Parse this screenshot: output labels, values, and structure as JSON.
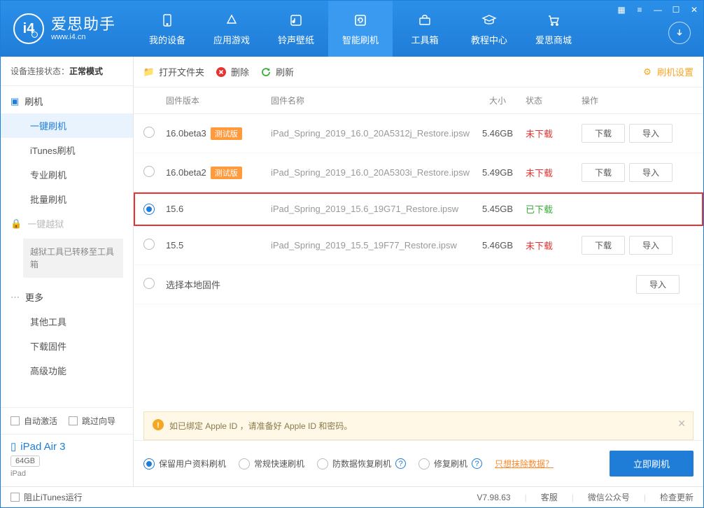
{
  "app": {
    "name": "爱思助手",
    "url": "www.i4.cn",
    "version": "V7.98.63"
  },
  "nav": [
    {
      "label": "我的设备"
    },
    {
      "label": "应用游戏"
    },
    {
      "label": "铃声壁纸"
    },
    {
      "label": "智能刷机"
    },
    {
      "label": "工具箱"
    },
    {
      "label": "教程中心"
    },
    {
      "label": "爱思商城"
    }
  ],
  "sidebar": {
    "status_prefix": "设备连接状态：",
    "status_value": "正常模式",
    "groups": {
      "flash": "刷机",
      "jailbreak": "一键越狱",
      "more": "更多"
    },
    "flash_items": [
      "一键刷机",
      "iTunes刷机",
      "专业刷机",
      "批量刷机"
    ],
    "jailbreak_note": "越狱工具已转移至工具箱",
    "more_items": [
      "其他工具",
      "下载固件",
      "高级功能"
    ],
    "auto_activate": "自动激活",
    "skip_guide": "跳过向导",
    "device": {
      "name": "iPad Air 3",
      "capacity": "64GB",
      "type": "iPad"
    }
  },
  "toolbar": {
    "open": "打开文件夹",
    "delete": "删除",
    "refresh": "刷新",
    "settings": "刷机设置"
  },
  "table": {
    "headers": {
      "version": "固件版本",
      "name": "固件名称",
      "size": "大小",
      "status": "状态",
      "ops": "操作"
    },
    "rows": [
      {
        "version": "16.0beta3",
        "beta": "测试版",
        "name": "iPad_Spring_2019_16.0_20A5312j_Restore.ipsw",
        "size": "5.46GB",
        "status": "未下载",
        "status_class": "red",
        "selected": false,
        "show_ops": true
      },
      {
        "version": "16.0beta2",
        "beta": "测试版",
        "name": "iPad_Spring_2019_16.0_20A5303i_Restore.ipsw",
        "size": "5.49GB",
        "status": "未下载",
        "status_class": "red",
        "selected": false,
        "show_ops": true
      },
      {
        "version": "15.6",
        "beta": "",
        "name": "iPad_Spring_2019_15.6_19G71_Restore.ipsw",
        "size": "5.45GB",
        "status": "已下载",
        "status_class": "green",
        "selected": true,
        "highlighted": true,
        "show_ops": false
      },
      {
        "version": "15.5",
        "beta": "",
        "name": "iPad_Spring_2019_15.5_19F77_Restore.ipsw",
        "size": "5.46GB",
        "status": "未下载",
        "status_class": "red",
        "selected": false,
        "show_ops": true
      },
      {
        "version": "",
        "beta": "",
        "name_main": "选择本地固件",
        "size": "",
        "status": "",
        "selected": false,
        "import_only": true
      }
    ],
    "download_btn": "下载",
    "import_btn": "导入"
  },
  "info_bar": "如已绑定 Apple ID ，请准备好 Apple ID 和密码。",
  "flash_options": [
    {
      "label": "保留用户资料刷机",
      "selected": true
    },
    {
      "label": "常规快速刷机",
      "selected": false
    },
    {
      "label": "防数据恢复刷机",
      "selected": false,
      "help": true
    },
    {
      "label": "修复刷机",
      "selected": false,
      "help": true
    }
  ],
  "only_erase_link": "只想抹除数据？",
  "flash_now_btn": "立即刷机",
  "footer": {
    "block_itunes": "阻止iTunes运行",
    "support": "客服",
    "wechat": "微信公众号",
    "check_update": "检查更新"
  }
}
